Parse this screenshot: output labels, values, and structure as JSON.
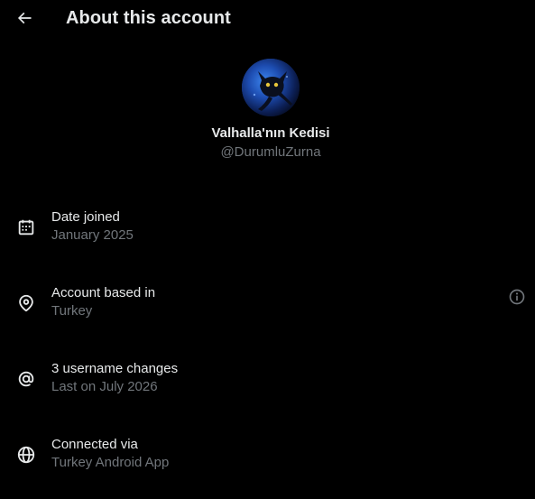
{
  "header": {
    "title": "About this account"
  },
  "profile": {
    "display_name": "Valhalla'nın Kedisi",
    "handle": "@DurumluZurna"
  },
  "items": [
    {
      "label": "Date joined",
      "value": "January 2025",
      "icon": "calendar-icon"
    },
    {
      "label": "Account based in",
      "value": "Turkey",
      "icon": "location-pin-icon"
    },
    {
      "label": "3 username changes",
      "value": "Last on July 2026",
      "icon": "at-sign-icon"
    },
    {
      "label": "Connected via",
      "value": "Turkey Android App",
      "icon": "globe-icon"
    }
  ],
  "colors": {
    "background": "#000000",
    "primary_text": "#e7e9ea",
    "secondary_text": "#71767b"
  }
}
